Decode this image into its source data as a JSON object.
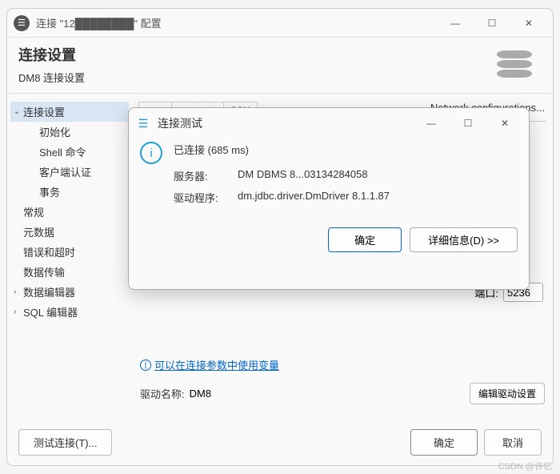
{
  "window": {
    "title": "连接 \"12████████\" 配置",
    "min": "—",
    "max": "☐",
    "close": "✕"
  },
  "header": {
    "title": "连接设置",
    "subtitle": "DM8 连接设置"
  },
  "sidebar": {
    "items": [
      {
        "label": "连接设置",
        "expanded": true
      },
      {
        "label": "初始化"
      },
      {
        "label": "Shell 命令"
      },
      {
        "label": "客户端认证"
      },
      {
        "label": "事务"
      }
    ],
    "others": [
      {
        "label": "常规"
      },
      {
        "label": "元数据"
      },
      {
        "label": "错误和超时"
      },
      {
        "label": "数据传输"
      },
      {
        "label": "数据编辑器",
        "hasChildren": true
      },
      {
        "label": "SQL 编辑器",
        "hasChildren": true
      }
    ]
  },
  "main": {
    "tabs": [
      {
        "label": "主要"
      },
      {
        "label": "驱动属性"
      },
      {
        "label": "SSH"
      }
    ],
    "networkConfig": "Network configurations...",
    "portLabel": "端口:",
    "portValue": "5236",
    "varLink": "可以在连接参数中使用变量",
    "driverLabel": "驱动名称:",
    "driverValue": "DM8",
    "editDriver": "编辑驱动设置"
  },
  "footer": {
    "test": "测试连接(T)...",
    "ok": "确定",
    "cancel": "取消"
  },
  "dialog": {
    "title": "连接测试",
    "min": "—",
    "max": "☐",
    "close": "✕",
    "message": "已连接 (685 ms)",
    "serverLabel": "服务器:",
    "serverValue": "DM DBMS 8...03134284058",
    "driverLabel": "驱动程序:",
    "driverValue": "dm.jdbc.driver.DmDriver 8.1.1.87",
    "ok": "确定",
    "detail": "详细信息(D) >>"
  },
  "watermark": "CSDN @许忆"
}
